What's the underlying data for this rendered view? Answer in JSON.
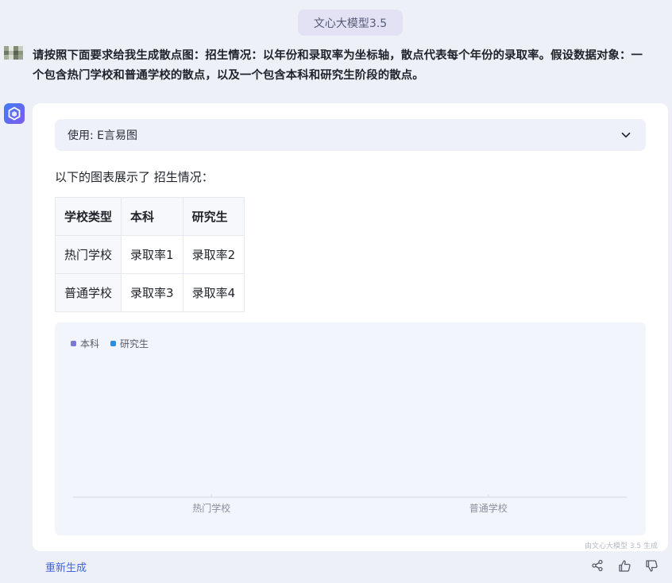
{
  "header": {
    "model_label": "文心大模型3.5"
  },
  "user_message": {
    "line1": "请按照下面要求给我生成散点图：招生情况：以年份和录取率为坐标轴，散点代表每个年份的录取率。假设数据对象：一",
    "line2": "个包含热门学校和普通学校的散点，以及一个包含本科和研究生阶段的散点。"
  },
  "response": {
    "plugin_label": "使用: E言易图",
    "intro": "以下的图表展示了 招生情况：",
    "table": {
      "headers": [
        "学校类型",
        "本科",
        "研究生"
      ],
      "rows": [
        [
          "热门学校",
          "录取率1",
          "录取率2"
        ],
        [
          "普通学校",
          "录取率3",
          "录取率4"
        ]
      ]
    }
  },
  "chart_data": {
    "type": "scatter",
    "categories": [
      "热门学校",
      "普通学校"
    ],
    "series": [
      {
        "name": "本科",
        "color": "#7b78d8",
        "values": []
      },
      {
        "name": "研究生",
        "color": "#2a8fe0",
        "values": []
      }
    ]
  },
  "footer": {
    "watermark": "由文心大模型 3.5 生成",
    "regenerate_label": "重新生成",
    "icons": [
      "share-icon",
      "thumbs-up-icon",
      "thumbs-down-icon"
    ]
  }
}
